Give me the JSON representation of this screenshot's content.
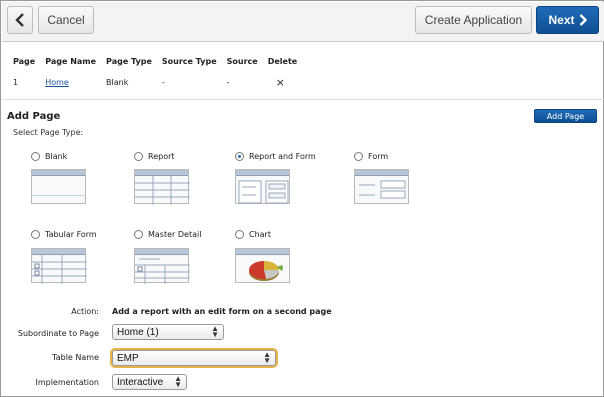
{
  "toolbar": {
    "back_icon": "chevron-left-icon",
    "cancel_label": "Cancel",
    "create_label": "Create Application",
    "next_label": "Next",
    "next_icon": "chevron-right-icon"
  },
  "pages_table": {
    "headers": [
      "Page",
      "Page Name",
      "Page Type",
      "Source Type",
      "Source",
      "Delete"
    ],
    "rows": [
      {
        "page": "1",
        "name": "Home",
        "type": "Blank",
        "source_type": "-",
        "source": "-",
        "delete": "×"
      }
    ]
  },
  "add_page": {
    "title": "Add Page",
    "button": "Add Page",
    "select_label": "Select Page Type:",
    "types": [
      {
        "label": "Blank",
        "selected": false
      },
      {
        "label": "Report",
        "selected": false
      },
      {
        "label": "Report and Form",
        "selected": true
      },
      {
        "label": "Form",
        "selected": false
      },
      {
        "label": "Tabular Form",
        "selected": false
      },
      {
        "label": "Master Detail",
        "selected": false
      },
      {
        "label": "Chart",
        "selected": false
      }
    ]
  },
  "form": {
    "action_label": "Action:",
    "action_value": "Add a report with an edit form on a second page",
    "subordinate_label": "Subordinate to Page",
    "subordinate_value": "Home (1)",
    "table_label": "Table Name",
    "table_value": "EMP",
    "implementation_label": "Implementation",
    "implementation_value": "Interactive"
  },
  "colors": {
    "accent": "#1660ad",
    "focus": "#e8b34b"
  }
}
